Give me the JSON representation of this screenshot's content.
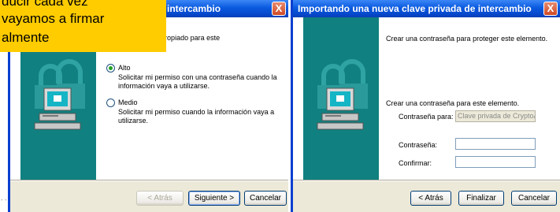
{
  "callout": {
    "line1": "ducir cada vez",
    "line2": "vayamos a firmar",
    "line3": "almente"
  },
  "dialog_security": {
    "title": "e intercambio",
    "close_label": "X",
    "intro": "el de seguridad apropiado para este",
    "options": [
      {
        "label": "Alto",
        "description_1": "Solicitar mi permiso con una contraseña cuando la",
        "description_2": "información vaya a utilizarse.",
        "selected": true
      },
      {
        "label": "Medio",
        "description_1": "Solicitar mi permiso cuando la información vaya a",
        "description_2": "utilizarse.",
        "selected": false
      }
    ],
    "buttons": {
      "back": "< Atrás",
      "next": "Siguiente >",
      "cancel": "Cancelar"
    }
  },
  "dialog_password": {
    "title": "Importando una nueva clave privada de intercambio",
    "close_label": "X",
    "intro": "Crear una contraseña para proteger este elemento.",
    "section_label": "Crear una contraseña para este elemento.",
    "fields": {
      "password_for_label": "Contraseña para:",
      "password_for_value": "Clave privada de CryptoA",
      "password_label": "Contraseña:",
      "password_value": "",
      "confirm_label": "Confirmar:",
      "confirm_value": ""
    },
    "buttons": {
      "back": "< Atrás",
      "finish": "Finalizar",
      "cancel": "Cancelar"
    }
  },
  "colors": {
    "titlebar": "#0a5ae0",
    "sidebar": "#118080",
    "dialog_bg": "#ece9d8",
    "callout": "#ffcc00",
    "radio_dot": "#21a121"
  },
  "icons": {
    "wizard_art": "computer-with-padlocks-icon",
    "close": "close-icon"
  }
}
